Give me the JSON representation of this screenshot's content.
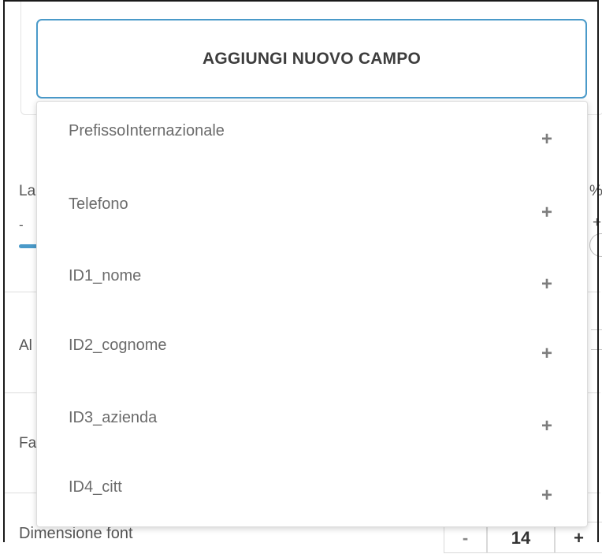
{
  "add_button": {
    "label": "AGGIUNGI NUOVO CAMPO"
  },
  "background": {
    "width_label": "La",
    "width_unit": "%",
    "width_minus": "-",
    "width_plus": "+",
    "align_label": "Al",
    "font_family_label": "Fa",
    "font_size_label": "Dimensione font",
    "font_size_minus": "-",
    "font_size_value": "14",
    "font_size_plus": "+"
  },
  "dropdown": {
    "plus_symbol": "+",
    "items": [
      {
        "label": "PrefissoInternazionale"
      },
      {
        "label": "Telefono"
      },
      {
        "label": "ID1_nome"
      },
      {
        "label": "ID2_cognome"
      },
      {
        "label": "ID3_azienda"
      },
      {
        "label": "ID4_citt"
      }
    ]
  },
  "colors": {
    "accent": "#4a9ac9",
    "text": "#6b6b6b",
    "border": "#dcdcdc"
  }
}
